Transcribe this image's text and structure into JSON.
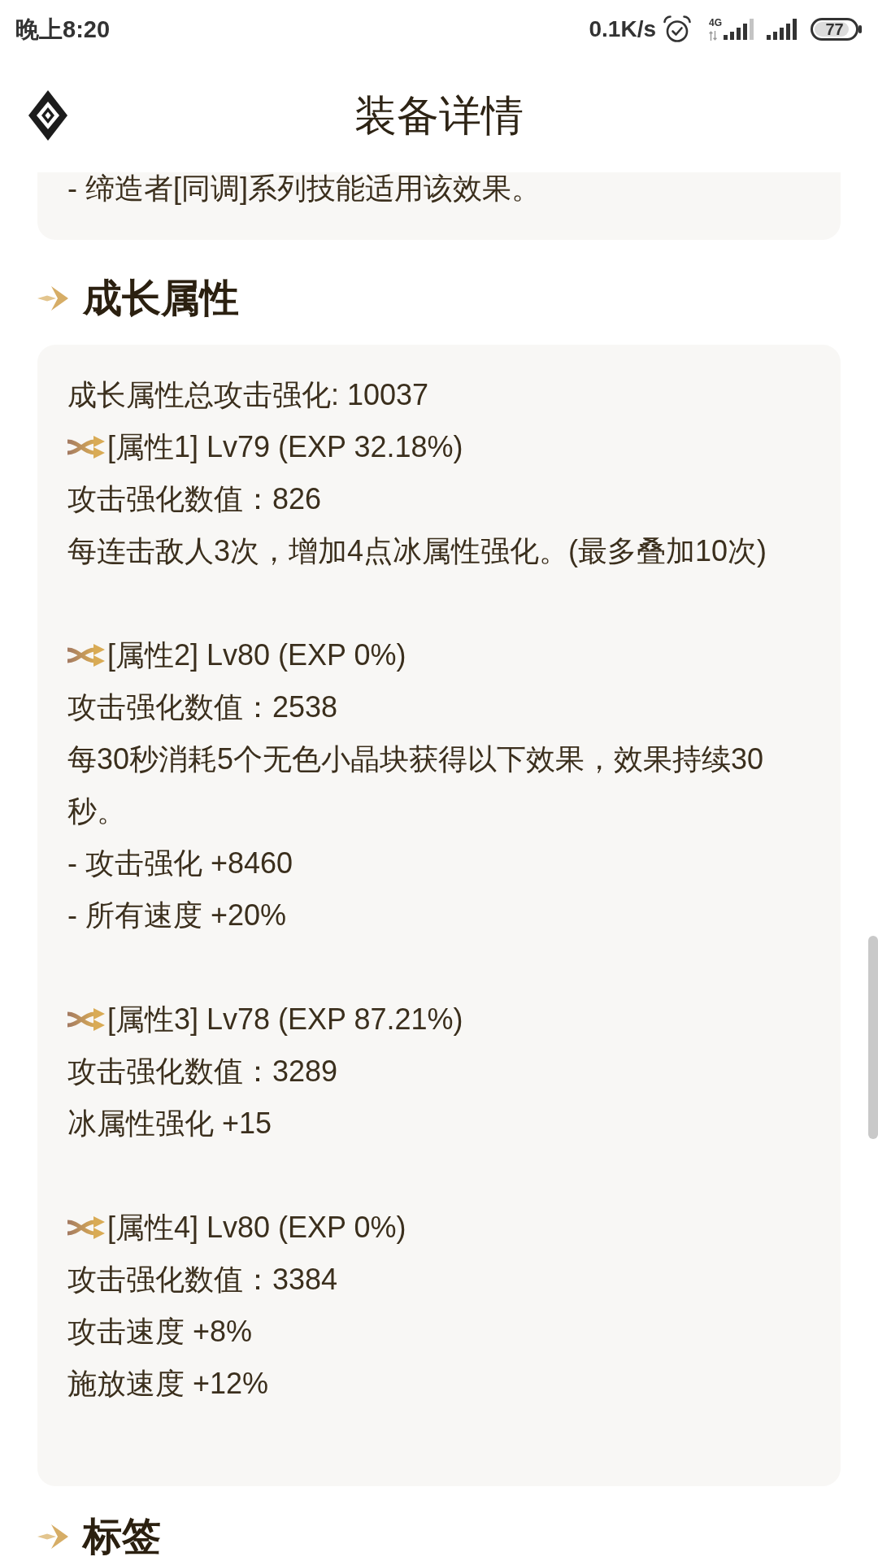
{
  "status_bar": {
    "time": "晚上8:20",
    "network_speed": "0.1K/s",
    "network_type": "4G",
    "battery": "77"
  },
  "header": {
    "title": "装备详情"
  },
  "top_card": {
    "lines": [
      "- 缔造者[同调]系列技能适用该效果。"
    ]
  },
  "sections": [
    {
      "heading": "成长属性",
      "card": {
        "summary": "成长属性总攻击强化: 10037",
        "attributes": [
          {
            "title": "[属性1] Lv79 (EXP 32.18%)",
            "lines": [
              "攻击强化数值：826",
              "每连击敌人3次，增加4点冰属性强化。(最多叠加10次)"
            ]
          },
          {
            "title": "[属性2] Lv80 (EXP 0%)",
            "lines": [
              "攻击强化数值：2538",
              "每30秒消耗5个无色小晶块获得以下效果，效果持续30秒。",
              "- 攻击强化 +8460",
              "- 所有速度 +20%"
            ]
          },
          {
            "title": "[属性3] Lv78 (EXP 87.21%)",
            "lines": [
              "攻击强化数值：3289",
              "冰属性强化 +15"
            ]
          },
          {
            "title": "[属性4] Lv80 (EXP 0%)",
            "lines": [
              "攻击强化数值：3384",
              "攻击速度 +8%",
              "施放速度 +12%"
            ]
          }
        ]
      }
    },
    {
      "heading": "标签"
    }
  ]
}
